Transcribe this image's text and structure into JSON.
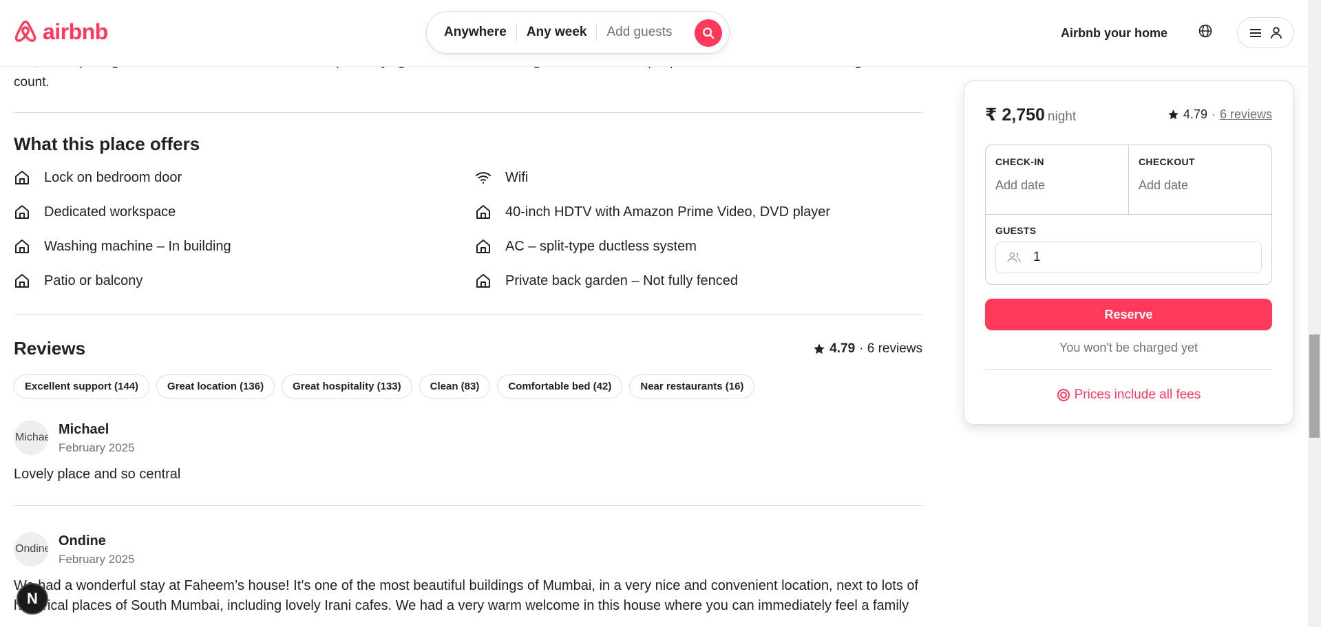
{
  "header": {
    "logo_text": "airbnb",
    "search": {
      "where": "Anywhere",
      "when": "Any week",
      "guests_placeholder": "Add guests"
    },
    "host_link": "Airbnb your home"
  },
  "rules_text": "this, so I'm putting this in. We're fine with unmarried couples staying here. Children of all ages are considered people and must be included in the guest count.",
  "offers": {
    "title": "What this place offers",
    "items": [
      {
        "label": "Lock on bedroom door",
        "icon": "home-icon"
      },
      {
        "label": "Wifi",
        "icon": "wifi-icon"
      },
      {
        "label": "Dedicated workspace",
        "icon": "home-icon"
      },
      {
        "label": "40-inch HDTV with Amazon Prime Video, DVD player",
        "icon": "home-icon"
      },
      {
        "label": "Washing machine – In building",
        "icon": "home-icon"
      },
      {
        "label": "AC – split-type ductless system",
        "icon": "home-icon"
      },
      {
        "label": "Patio or balcony",
        "icon": "home-icon"
      },
      {
        "label": "Private back garden – Not fully fenced",
        "icon": "home-icon"
      }
    ]
  },
  "reviews": {
    "title": "Reviews",
    "rating": "4.79",
    "count_text": "· 6 reviews",
    "tags": [
      "Excellent support (144)",
      "Great location (136)",
      "Great hospitality (133)",
      "Clean (83)",
      "Comfortable bed (42)",
      "Near restaurants (16)"
    ],
    "items": [
      {
        "name": "Michael",
        "avatar_alt": "Michael",
        "date": "February 2025",
        "text": "Lovely place and so central"
      },
      {
        "name": "Ondine",
        "avatar_alt": "Ondine",
        "date": "February 2025",
        "text": "We had a wonderful stay at Faheem’s house! It’s one of the most beautiful buildings of Mumbai, in a very nice and convenient location, next to lots of historical places of South Mumbai, including lovely Irani cafes. We had a very warm welcome in this house where you can immediately feel a family"
      }
    ]
  },
  "booking": {
    "price": "₹ 2,750",
    "price_unit": "night",
    "rating": "4.79",
    "rating_sep": "·",
    "reviews_link": "6 reviews",
    "checkin_label": "CHECK-IN",
    "checkin_value": "Add date",
    "checkout_label": "CHECKOUT",
    "checkout_value": "Add date",
    "guests_label": "GUESTS",
    "guests_value": "1",
    "reserve_label": "Reserve",
    "no_charge_text": "You won't be charged yet",
    "fees_text": "Prices include all fees"
  },
  "floating_badge": "N",
  "colors": {
    "brand": "#ff385c",
    "text": "#222222",
    "muted": "#717171"
  }
}
